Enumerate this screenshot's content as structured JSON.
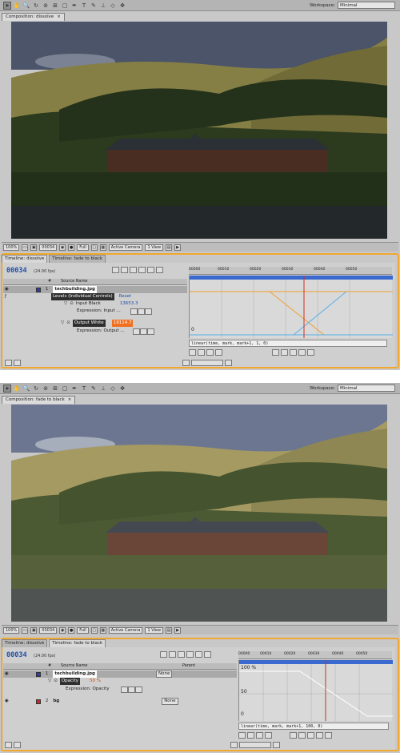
{
  "top": {
    "workspace_label": "Workspace:",
    "workspace_value": "Minimal",
    "comp_tab": "Composition: dissolve",
    "viewer": {
      "zoom": "100%",
      "timecode": "00034",
      "resolution": "Full",
      "camera": "Active Camera",
      "views": "1 View"
    },
    "timeline_tabs": [
      "Timeline: dissolve",
      "Timeline: fade to black"
    ],
    "timecode": "00034",
    "fps": "(24.00 fps)",
    "col_num": "#",
    "col_source": "Source Name",
    "layer": {
      "num": "1",
      "name": "techbuilding.jpg"
    },
    "effect": {
      "name": "Levels (Individual Controls)",
      "reset": "Reset"
    },
    "input_black": {
      "label": "Input Black",
      "value": "13653.3"
    },
    "expr_input": "Expression: Input ...",
    "output_white": {
      "label": "Output White",
      "value": "19114.7"
    },
    "expr_output": "Expression: Output ...",
    "ruler_ticks": [
      "00000",
      "00010",
      "00020",
      "00030",
      "00040",
      "00050"
    ],
    "graph_zero": "0",
    "expression": "linear(time, mark, mark+1, 1, 0)"
  },
  "bottom": {
    "workspace_label": "Workspace:",
    "workspace_value": "Minimal",
    "comp_tab": "Composition: fade to black",
    "viewer": {
      "zoom": "100%",
      "timecode": "00034",
      "resolution": "Full",
      "camera": "Active Camera",
      "views": "1 View"
    },
    "timeline_tabs": [
      "Timeline: dissolve",
      "Timeline: fade to black"
    ],
    "timecode": "00034",
    "fps": "(24.00 fps)",
    "col_num": "#",
    "col_source": "Source Name",
    "col_parent": "Parent",
    "layer1": {
      "num": "1",
      "name": "techbuilding.jpg",
      "parent": "None"
    },
    "opacity": {
      "label": "Opacity",
      "value": "50 %"
    },
    "expr_opacity": "Expression: Opacity",
    "layer2": {
      "num": "2",
      "name": "bg",
      "parent": "None"
    },
    "ruler_ticks": [
      "00000",
      "00010",
      "00020",
      "00030",
      "00040",
      "00050"
    ],
    "graph_100": "100 %",
    "graph_50": "50",
    "graph_0": "0",
    "expression": "linear(time, mark, mark+1, 100, 0)"
  }
}
